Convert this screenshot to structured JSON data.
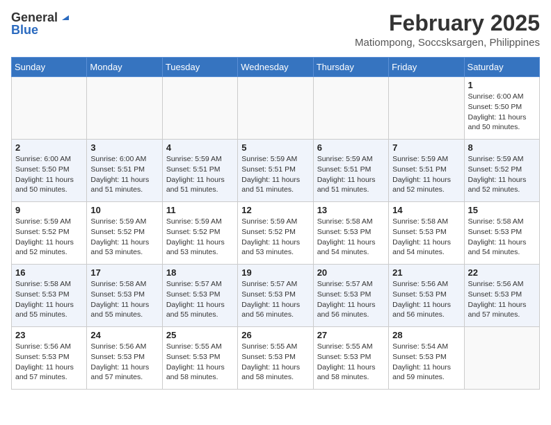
{
  "header": {
    "logo_general": "General",
    "logo_blue": "Blue",
    "month": "February 2025",
    "location": "Matiompong, Soccsksargen, Philippines"
  },
  "days_of_week": [
    "Sunday",
    "Monday",
    "Tuesday",
    "Wednesday",
    "Thursday",
    "Friday",
    "Saturday"
  ],
  "weeks": [
    [
      {
        "day": "",
        "info": ""
      },
      {
        "day": "",
        "info": ""
      },
      {
        "day": "",
        "info": ""
      },
      {
        "day": "",
        "info": ""
      },
      {
        "day": "",
        "info": ""
      },
      {
        "day": "",
        "info": ""
      },
      {
        "day": "1",
        "info": "Sunrise: 6:00 AM\nSunset: 5:50 PM\nDaylight: 11 hours\nand 50 minutes."
      }
    ],
    [
      {
        "day": "2",
        "info": "Sunrise: 6:00 AM\nSunset: 5:50 PM\nDaylight: 11 hours\nand 50 minutes."
      },
      {
        "day": "3",
        "info": "Sunrise: 6:00 AM\nSunset: 5:51 PM\nDaylight: 11 hours\nand 51 minutes."
      },
      {
        "day": "4",
        "info": "Sunrise: 5:59 AM\nSunset: 5:51 PM\nDaylight: 11 hours\nand 51 minutes."
      },
      {
        "day": "5",
        "info": "Sunrise: 5:59 AM\nSunset: 5:51 PM\nDaylight: 11 hours\nand 51 minutes."
      },
      {
        "day": "6",
        "info": "Sunrise: 5:59 AM\nSunset: 5:51 PM\nDaylight: 11 hours\nand 51 minutes."
      },
      {
        "day": "7",
        "info": "Sunrise: 5:59 AM\nSunset: 5:51 PM\nDaylight: 11 hours\nand 52 minutes."
      },
      {
        "day": "8",
        "info": "Sunrise: 5:59 AM\nSunset: 5:52 PM\nDaylight: 11 hours\nand 52 minutes."
      }
    ],
    [
      {
        "day": "9",
        "info": "Sunrise: 5:59 AM\nSunset: 5:52 PM\nDaylight: 11 hours\nand 52 minutes."
      },
      {
        "day": "10",
        "info": "Sunrise: 5:59 AM\nSunset: 5:52 PM\nDaylight: 11 hours\nand 53 minutes."
      },
      {
        "day": "11",
        "info": "Sunrise: 5:59 AM\nSunset: 5:52 PM\nDaylight: 11 hours\nand 53 minutes."
      },
      {
        "day": "12",
        "info": "Sunrise: 5:59 AM\nSunset: 5:52 PM\nDaylight: 11 hours\nand 53 minutes."
      },
      {
        "day": "13",
        "info": "Sunrise: 5:58 AM\nSunset: 5:53 PM\nDaylight: 11 hours\nand 54 minutes."
      },
      {
        "day": "14",
        "info": "Sunrise: 5:58 AM\nSunset: 5:53 PM\nDaylight: 11 hours\nand 54 minutes."
      },
      {
        "day": "15",
        "info": "Sunrise: 5:58 AM\nSunset: 5:53 PM\nDaylight: 11 hours\nand 54 minutes."
      }
    ],
    [
      {
        "day": "16",
        "info": "Sunrise: 5:58 AM\nSunset: 5:53 PM\nDaylight: 11 hours\nand 55 minutes."
      },
      {
        "day": "17",
        "info": "Sunrise: 5:58 AM\nSunset: 5:53 PM\nDaylight: 11 hours\nand 55 minutes."
      },
      {
        "day": "18",
        "info": "Sunrise: 5:57 AM\nSunset: 5:53 PM\nDaylight: 11 hours\nand 55 minutes."
      },
      {
        "day": "19",
        "info": "Sunrise: 5:57 AM\nSunset: 5:53 PM\nDaylight: 11 hours\nand 56 minutes."
      },
      {
        "day": "20",
        "info": "Sunrise: 5:57 AM\nSunset: 5:53 PM\nDaylight: 11 hours\nand 56 minutes."
      },
      {
        "day": "21",
        "info": "Sunrise: 5:56 AM\nSunset: 5:53 PM\nDaylight: 11 hours\nand 56 minutes."
      },
      {
        "day": "22",
        "info": "Sunrise: 5:56 AM\nSunset: 5:53 PM\nDaylight: 11 hours\nand 57 minutes."
      }
    ],
    [
      {
        "day": "23",
        "info": "Sunrise: 5:56 AM\nSunset: 5:53 PM\nDaylight: 11 hours\nand 57 minutes."
      },
      {
        "day": "24",
        "info": "Sunrise: 5:56 AM\nSunset: 5:53 PM\nDaylight: 11 hours\nand 57 minutes."
      },
      {
        "day": "25",
        "info": "Sunrise: 5:55 AM\nSunset: 5:53 PM\nDaylight: 11 hours\nand 58 minutes."
      },
      {
        "day": "26",
        "info": "Sunrise: 5:55 AM\nSunset: 5:53 PM\nDaylight: 11 hours\nand 58 minutes."
      },
      {
        "day": "27",
        "info": "Sunrise: 5:55 AM\nSunset: 5:53 PM\nDaylight: 11 hours\nand 58 minutes."
      },
      {
        "day": "28",
        "info": "Sunrise: 5:54 AM\nSunset: 5:53 PM\nDaylight: 11 hours\nand 59 minutes."
      },
      {
        "day": "",
        "info": ""
      }
    ]
  ]
}
